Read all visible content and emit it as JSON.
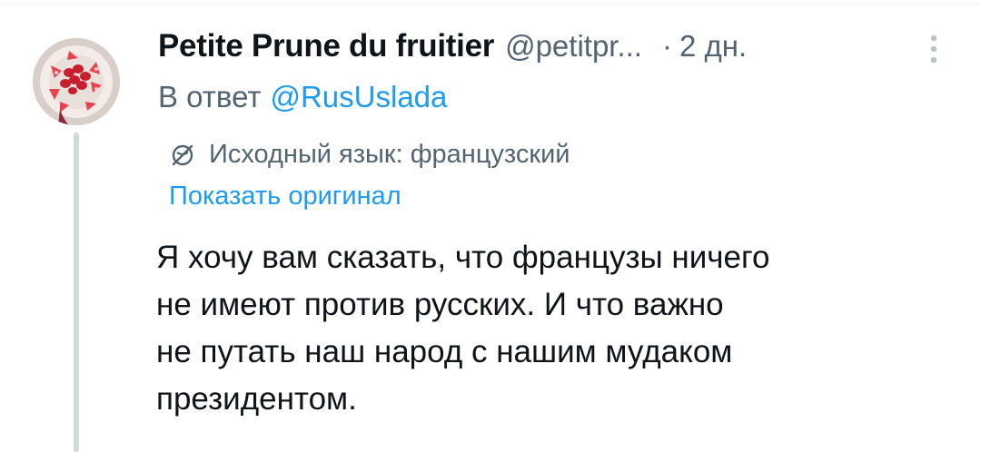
{
  "tweet": {
    "display_name": "Petite Prune du fruitier",
    "handle": "@petitpr...",
    "separator": "·",
    "timestamp": "2 дн.",
    "reply_prefix": "В ответ",
    "reply_to": "@RusUslada",
    "translation_label": "Исходный язык: французский",
    "show_original": "Показать оригинал",
    "text_lines": [
      "Я хочу вам сказать, что французы ничего",
      "не имеют против русских. И что важно",
      "не путать наш народ с нашим мудаком",
      "президентом."
    ]
  },
  "icons": {
    "more": "more-vertical-icon",
    "translate": "translate-globe-icon"
  },
  "colors": {
    "text_primary": "#0f1419",
    "text_secondary": "#536471",
    "accent": "#1d9bf0",
    "thread_line": "#cfd9de"
  }
}
